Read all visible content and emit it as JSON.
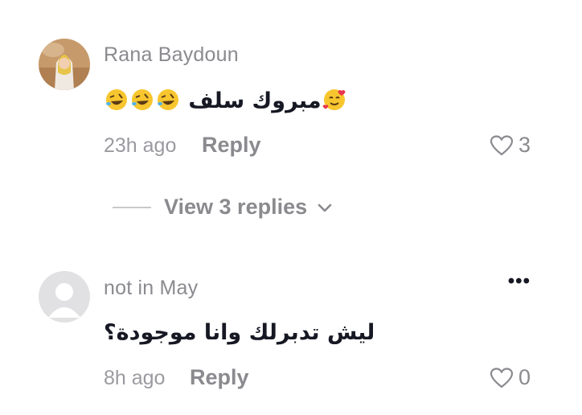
{
  "comments": [
    {
      "username": "Rana Baydoun",
      "text": "مبروك سلف",
      "emoji_before": [
        "rolling-on-floor-laughing",
        "rolling-on-floor-laughing",
        "rolling-on-floor-laughing"
      ],
      "emoji_after": [
        "smiling-face-with-hearts"
      ],
      "time": "23h ago",
      "reply_label": "Reply",
      "likes": "3"
    },
    {
      "username": "not in May",
      "text": "ليش تدبرلك وانا موجودة؟",
      "time": "8h ago",
      "reply_label": "Reply",
      "likes": "0"
    }
  ],
  "view_replies": {
    "label": "View 3 replies"
  },
  "colors": {
    "muted": "#8a8a8f",
    "text": "#161823",
    "avatar_placeholder": "#e1e1e3"
  }
}
